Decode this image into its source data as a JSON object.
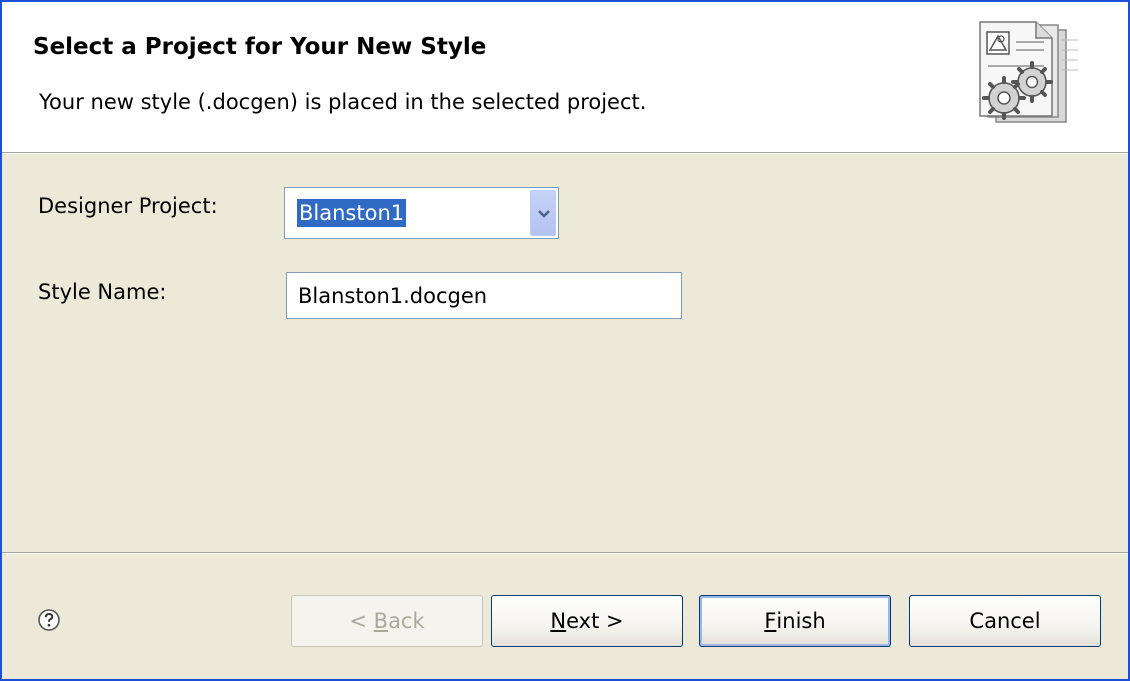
{
  "header": {
    "title": "Select a Project for Your New Style",
    "description": "Your new style (.docgen) is placed in the selected project.",
    "banner_icon": "document-gears-icon"
  },
  "form": {
    "project_label": "Designer Project:",
    "project_value": "Blanston1",
    "style_name_label": "Style Name:",
    "style_name_value": "Blanston1.docgen"
  },
  "buttons": {
    "help_icon": "help-icon",
    "back_prefix": "< ",
    "back_mnemonic": "B",
    "back_rest": "ack",
    "next_mnemonic": "N",
    "next_rest": "ext >",
    "finish_mnemonic": "F",
    "finish_rest": "inish",
    "cancel": "Cancel"
  },
  "colors": {
    "selection": "#316ac5",
    "window_border": "#1f4fd6",
    "dialog_bg": "#ece9d8"
  }
}
